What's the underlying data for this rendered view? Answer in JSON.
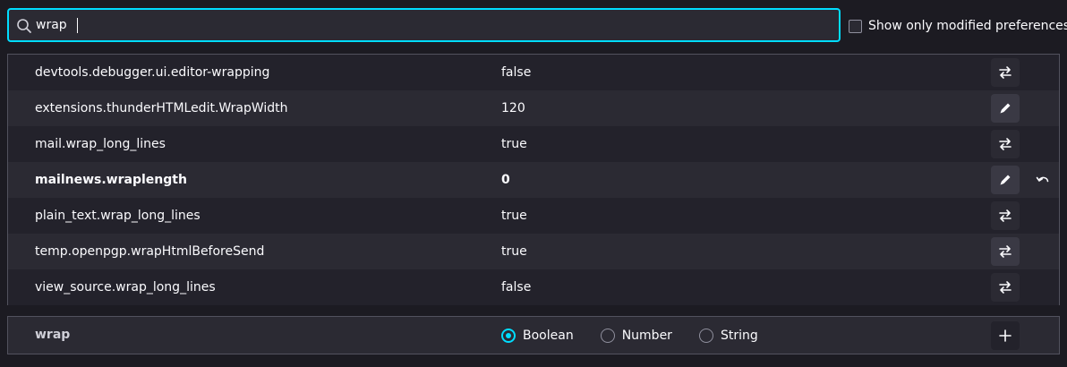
{
  "search": {
    "value": "wrap",
    "icon": "search-icon"
  },
  "modified_toggle": {
    "label": "Show only modified preferences",
    "checked": false
  },
  "prefs": [
    {
      "name": "devtools.debugger.ui.editor-wrapping",
      "value": "false",
      "action": "toggle-icon",
      "modified": false
    },
    {
      "name": "extensions.thunderHTMLedit.WrapWidth",
      "value": "120",
      "action": "edit-icon",
      "modified": false
    },
    {
      "name": "mail.wrap_long_lines",
      "value": "true",
      "action": "toggle-icon",
      "modified": false
    },
    {
      "name": "mailnews.wraplength",
      "value": "0",
      "action": "edit-icon",
      "modified": true
    },
    {
      "name": "plain_text.wrap_long_lines",
      "value": "true",
      "action": "toggle-icon",
      "modified": false
    },
    {
      "name": "temp.openpgp.wrapHtmlBeforeSend",
      "value": "true",
      "action": "toggle-icon",
      "modified": false
    },
    {
      "name": "view_source.wrap_long_lines",
      "value": "false",
      "action": "toggle-icon",
      "modified": false
    }
  ],
  "add_row": {
    "name": "wrap",
    "types": [
      {
        "label": "Boolean",
        "checked": true
      },
      {
        "label": "Number",
        "checked": false
      },
      {
        "label": "String",
        "checked": false
      }
    ],
    "add_icon": "plus-icon"
  },
  "colors": {
    "accent": "#00ddff",
    "background": "#1c1b22",
    "row_dark": "#23222b",
    "row_light": "#2b2a33"
  }
}
